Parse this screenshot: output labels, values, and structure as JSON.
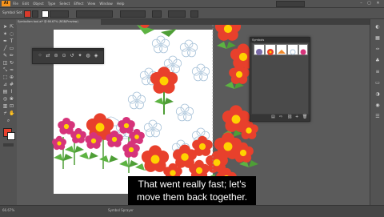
{
  "app": {
    "logo": "Ai",
    "menus": [
      "File",
      "Edit",
      "Object",
      "Type",
      "Select",
      "Effect",
      "View",
      "Window",
      "Help"
    ],
    "window_controls": [
      "–",
      "▢",
      "✕"
    ]
  },
  "control_bar": {
    "label": "Symbol Set"
  },
  "document_tab": {
    "label": "Symbolism tool.ai* @ 66.67% (RGB/Preview)"
  },
  "symbols_panel": {
    "title": "Symbols"
  },
  "status": {
    "zoom": "66.67%",
    "selection": "Symbol Sprayer"
  },
  "caption": {
    "line1": "That went really fast; let's",
    "line2": "move them back together."
  },
  "colors": {
    "accent": "#f7941d",
    "ui_dark": "#535353",
    "flower_red": "#e8402c",
    "flower_pink": "#d6337a",
    "flower_center": "#ffd200",
    "leaf_green": "#5db342"
  },
  "icons": [
    "selection-icon",
    "direct-selection-icon",
    "magic-wand-icon",
    "lasso-icon",
    "pen-icon",
    "type-icon",
    "line-icon",
    "rectangle-icon",
    "brush-icon",
    "pencil-icon",
    "eraser-icon",
    "rotate-icon",
    "scale-icon",
    "warp-icon",
    "free-transform-icon",
    "shape-builder-icon",
    "perspective-icon",
    "mesh-icon",
    "gradient-icon",
    "eyedropper-icon",
    "blend-icon",
    "symbol-sprayer-icon",
    "graph-icon",
    "artboard-icon",
    "slice-icon",
    "hand-icon",
    "zoom-icon"
  ]
}
